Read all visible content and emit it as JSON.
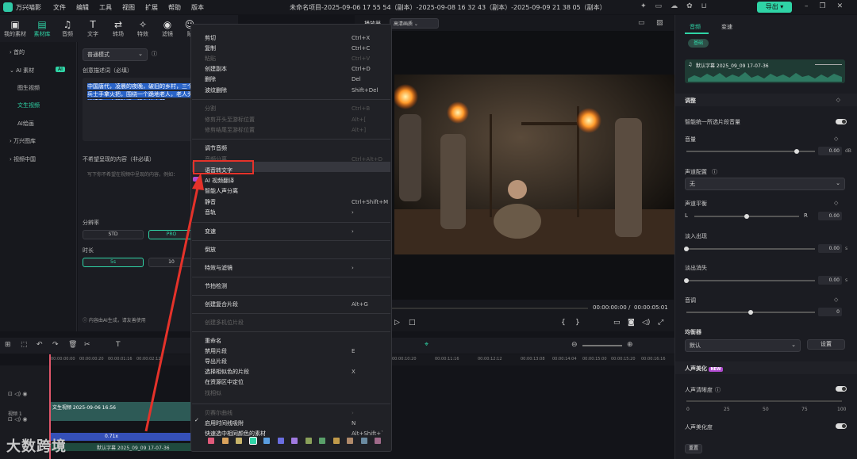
{
  "app": {
    "title": "万兴喵影",
    "menu": [
      "文件",
      "编辑",
      "工具",
      "视图",
      "扩展",
      "帮助",
      "版本"
    ],
    "document_title": "未命名项目-2025-09-06 17 55 54（副本）-2025-09-08 16 32 43（副本）-2025-09-09 21 38 05（副本）",
    "export_label": "导出",
    "accent": "#2fd4a6"
  },
  "toolbar": {
    "tabs": [
      {
        "label": "我的素材",
        "icon": "folder-icon"
      },
      {
        "label": "素材库",
        "icon": "library-icon"
      },
      {
        "label": "音频",
        "icon": "music-icon"
      },
      {
        "label": "文字",
        "icon": "text-icon"
      },
      {
        "label": "转场",
        "icon": "transition-icon"
      },
      {
        "label": "特效",
        "icon": "effects-icon"
      },
      {
        "label": "滤镜",
        "icon": "filter-icon"
      },
      {
        "label": "贴",
        "icon": "sticker-icon"
      }
    ]
  },
  "leftnav": {
    "items": [
      "首的",
      "AI 素材",
      "图生视频",
      "文生视频",
      "AI绘画",
      "万兴图库",
      "视频中国"
    ],
    "ai_badge": "AI"
  },
  "ai_panel": {
    "mode": "普通模式",
    "prompt_label": "创意描述词（必填）",
    "prompt_text": "中国唐代，凌晨的夜晚，破旧的乡村，三个兵士手拿火把，围绕一个跪地老人，老人头发凌乱，衣服破旧，跪在地上哭",
    "exclude_label": "不希望呈现的内容（非必填）",
    "exclude_placeholder": "写下你不希望在视频中呈现的内容，例如：",
    "resolution_label": "分辨率",
    "res_std": "STD",
    "res_pro": "PRO",
    "duration_label": "时长",
    "dur_5s": "5s",
    "dur_10s": "10",
    "footer": "内容由AI生成，请友善使用"
  },
  "preview": {
    "player_label": "播放器",
    "quality": "高清画质",
    "time_current": "00:00:00:00",
    "time_total": "00:00:05:01"
  },
  "context_menu": {
    "items": [
      {
        "label": "剪切",
        "shortcut": "Ctrl+X",
        "disabled": false
      },
      {
        "label": "复制",
        "shortcut": "Ctrl+C",
        "disabled": false
      },
      {
        "label": "粘贴",
        "shortcut": "Ctrl+V",
        "disabled": true
      },
      {
        "label": "创建副本",
        "shortcut": "Ctrl+D",
        "disabled": false
      },
      {
        "label": "删除",
        "shortcut": "Del",
        "disabled": false
      },
      {
        "label": "波纹删除",
        "shortcut": "Shift+Del",
        "disabled": false
      },
      {
        "label": "分割",
        "shortcut": "Ctrl+B",
        "disabled": true
      },
      {
        "label": "修剪开头至游标位置",
        "shortcut": "Alt+[",
        "disabled": true
      },
      {
        "label": "修剪结尾至游标位置",
        "shortcut": "Alt+]",
        "disabled": true
      },
      {
        "label": "调节音频",
        "shortcut": "",
        "disabled": false
      },
      {
        "label": "音频分离",
        "shortcut": "Ctrl+Alt+D",
        "disabled": true
      },
      {
        "label": "语音转文字",
        "shortcut": "",
        "disabled": false
      },
      {
        "label": "AI 视频翻译",
        "shortcut": "",
        "disabled": false
      },
      {
        "label": "智能人声分离",
        "shortcut": "",
        "disabled": false
      },
      {
        "label": "静音",
        "shortcut": "Ctrl+Shift+M",
        "disabled": false
      },
      {
        "label": "音轨",
        "shortcut": "›",
        "disabled": false
      },
      {
        "label": "变速",
        "shortcut": "›",
        "disabled": false
      },
      {
        "label": "倒放",
        "shortcut": "",
        "disabled": false
      },
      {
        "label": "特效与滤镜",
        "shortcut": "›",
        "disabled": false
      },
      {
        "label": "节拍检测",
        "shortcut": "",
        "disabled": false
      },
      {
        "label": "创建复合片段",
        "shortcut": "Alt+G",
        "disabled": false
      },
      {
        "label": "创建多机位片段",
        "shortcut": "",
        "disabled": true
      },
      {
        "label": "重命名",
        "shortcut": "",
        "disabled": false
      },
      {
        "label": "禁用片段",
        "shortcut": "E",
        "disabled": false
      },
      {
        "label": "导出片段",
        "shortcut": "",
        "disabled": false
      },
      {
        "label": "选择相似色的片段",
        "shortcut": "X",
        "disabled": false
      },
      {
        "label": "在资源区中定位",
        "shortcut": "",
        "disabled": false
      },
      {
        "label": "找相似",
        "shortcut": "",
        "disabled": true
      },
      {
        "label": "贝赛尔曲线",
        "shortcut": "›",
        "disabled": true
      },
      {
        "label": "启用时间线吸附",
        "shortcut": "N",
        "disabled": false
      },
      {
        "label": "快速选中相同颜色的素材",
        "shortcut": "Alt+Shift+`",
        "disabled": false
      }
    ],
    "swatches": [
      "#e05a7a",
      "#d9a25c",
      "#c8b46a",
      "#2fd4a6",
      "#5a9ee0",
      "#6a6ee0",
      "#a07ae0",
      "#8aa05a",
      "#5aa06a",
      "#c09a4a",
      "#b08a6a",
      "#6a8aa0",
      "#a06a8a"
    ]
  },
  "right_panel": {
    "tabs": [
      "音频",
      "变速"
    ],
    "basic_label": "基础",
    "clip_name": "默认字幕 2025_09_09 17-07-36",
    "sections": {
      "adjust": "调整",
      "eq": "均衡器",
      "voice": "人声美化"
    },
    "smart_volume": "智能统一所选片段音量",
    "volume": {
      "label": "音量",
      "value": "0.00",
      "unit": "dB",
      "level": 0.86
    },
    "channel": {
      "label": "声道配置",
      "value": "无"
    },
    "balance": {
      "label": "声道平衡",
      "left": "L",
      "right": "R",
      "value": "0.00",
      "level": 0.5
    },
    "fade_in": {
      "label": "淡入出现",
      "value": "0.00",
      "unit": "s",
      "level": 0
    },
    "fade_out": {
      "label": "淡出消失",
      "value": "0.00",
      "unit": "s",
      "level": 0
    },
    "pitch": {
      "label": "音调",
      "value": "0",
      "level": 0.5
    },
    "eq_value": "默认",
    "eq_setting": "设置",
    "voice_badge": "NEW",
    "voice_clarity": "人声清晰度",
    "ticks": [
      "0",
      "25",
      "50",
      "75",
      "100"
    ],
    "voice_beautify": "人声美化度",
    "reset": "重置"
  },
  "timeline": {
    "ruler": [
      "00:00:00:00",
      "00:00:00:20",
      "00:00:01:16",
      "00:00:02:12",
      "00:00:10:20",
      "00:00:11:16",
      "00:00:12:12",
      "00:00:13:08",
      "00:00:14:04",
      "00:00:15:00",
      "00:00:15:20",
      "00:00:16:16"
    ],
    "video_clip": "文生视频 2025-09-06 16:56",
    "track_label": "视频 1",
    "audio_speed": "0.71x",
    "audio_clip": "默认字幕 2025_09_09 17-07-36"
  },
  "watermark": "大数跨境"
}
